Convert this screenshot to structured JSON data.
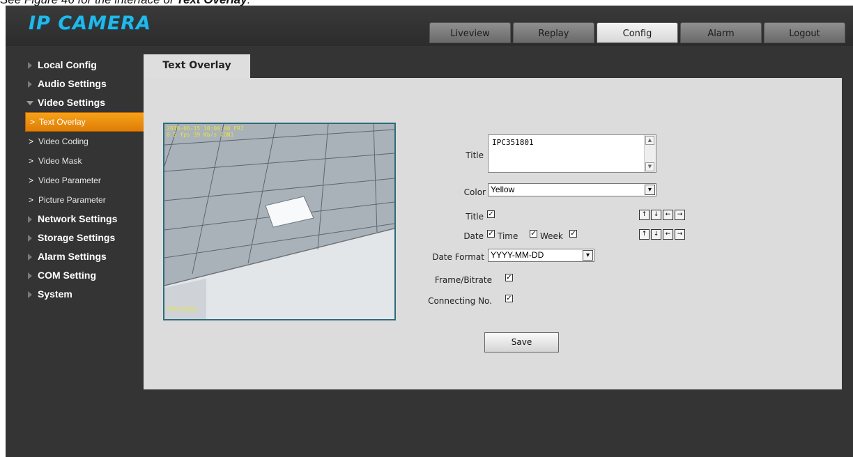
{
  "caption": {
    "prefix": "See Figure 46 for the interface of ",
    "bold": "Text Overlay",
    "suffix": "."
  },
  "app": {
    "logo": "IP CAMERA"
  },
  "topnav": {
    "tabs": [
      {
        "label": "Liveview",
        "active": false
      },
      {
        "label": "Replay",
        "active": false
      },
      {
        "label": "Config",
        "active": true
      },
      {
        "label": "Alarm",
        "active": false
      },
      {
        "label": "Logout",
        "active": false
      }
    ]
  },
  "sidebar": {
    "items": [
      {
        "label": "Local Config"
      },
      {
        "label": "Audio Settings"
      },
      {
        "label": "Video Settings",
        "expanded": true
      },
      {
        "label": "Network Settings"
      },
      {
        "label": "Storage Settings"
      },
      {
        "label": "Alarm Settings"
      },
      {
        "label": "COM Setting"
      },
      {
        "label": "System"
      }
    ],
    "sub": [
      {
        "label": "Text Overlay",
        "active": true
      },
      {
        "label": "Video Coding"
      },
      {
        "label": "Video Mask"
      },
      {
        "label": "Video Parameter"
      },
      {
        "label": "Picture Parameter"
      }
    ]
  },
  "main": {
    "tab": "Text Overlay",
    "video": {
      "osd_top_line1": "2018-06-15 10:00:00 FRI",
      "osd_top_line2": "0.5 fps 39 Kb/s CON1",
      "osd_bottom": "IPC351801"
    },
    "form": {
      "title_label": "Title",
      "title_value": "IPC351801",
      "color_label": "Color",
      "color_value": "Yellow",
      "title_check_label": "Title",
      "title_checked": true,
      "date_label": "Date",
      "date_checked": true,
      "time_label": "Time",
      "time_checked": true,
      "week_label": "Week",
      "week_checked": true,
      "date_format_label": "Date Format",
      "date_format_value": "YYYY-MM-DD",
      "frame_label": "Frame/Bitrate",
      "frame_checked": true,
      "connecting_label": "Connecting No.",
      "connecting_checked": true,
      "save_label": "Save"
    },
    "arrow_icons": [
      "arrow-up-icon",
      "arrow-down-icon",
      "arrow-left-icon",
      "arrow-right-icon"
    ]
  },
  "colors": {
    "accent": "#e88a0c",
    "logo": "#22b8e8",
    "background": "#343434",
    "panel": "#dcdcdc"
  }
}
